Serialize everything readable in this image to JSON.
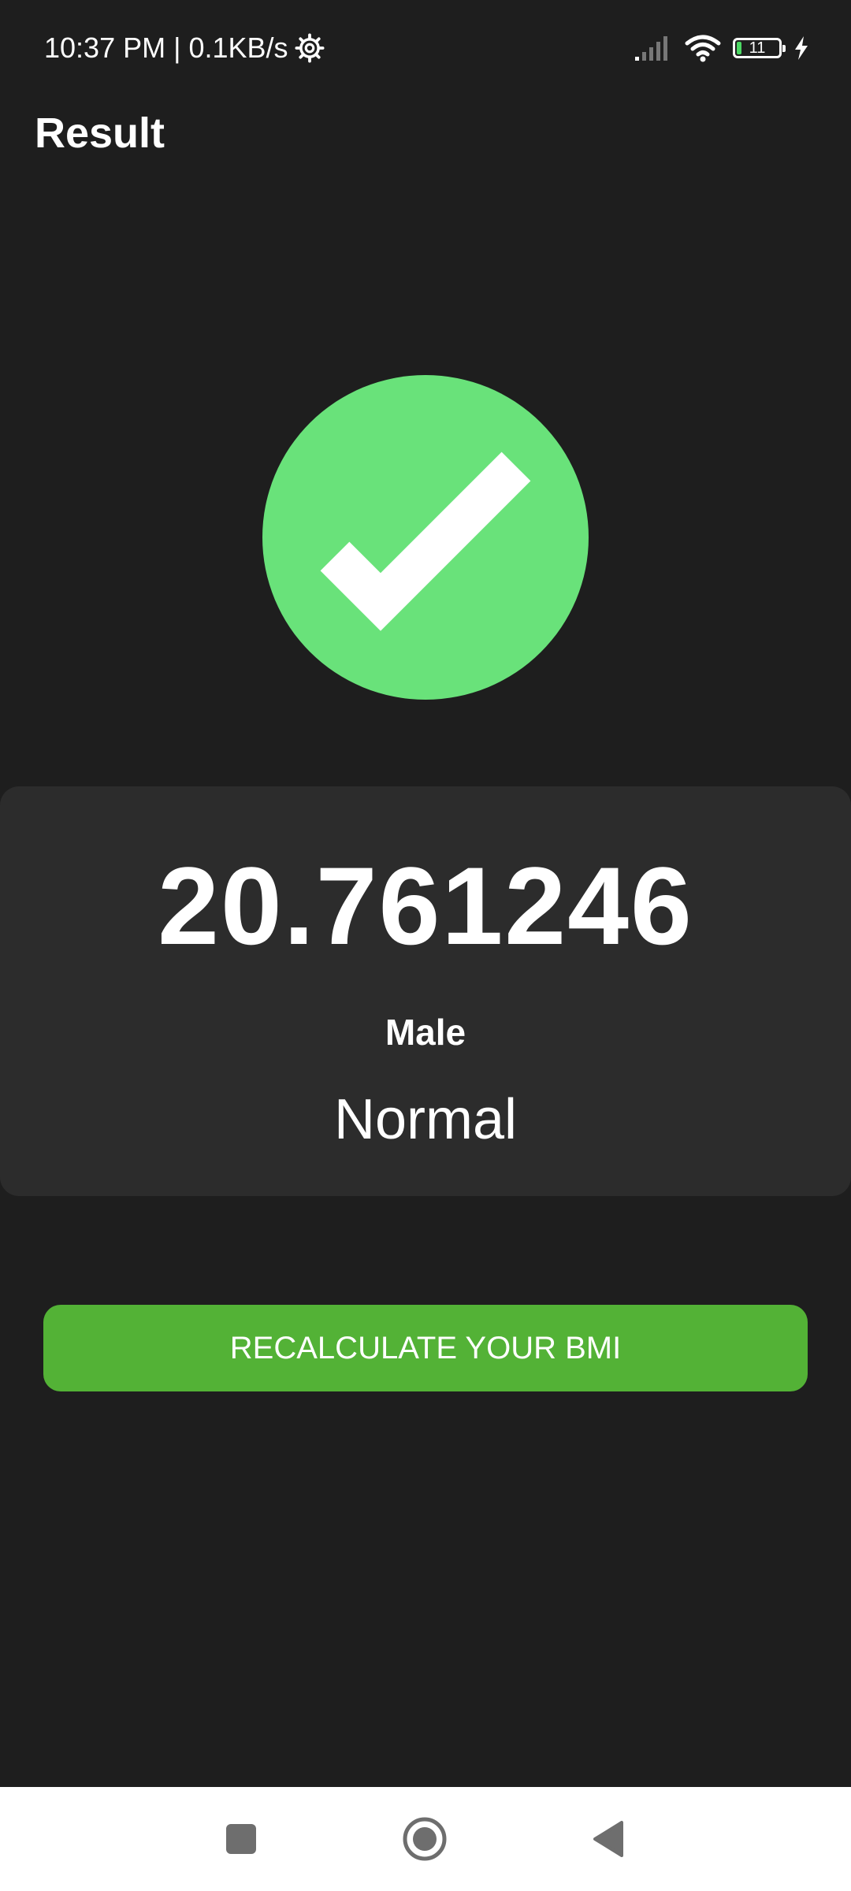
{
  "status_bar": {
    "time_speed": "10:37 PM | 0.1KB/s",
    "battery_level": "11",
    "icons": [
      "settings-gear-icon",
      "signal-icon",
      "wifi-icon",
      "battery-icon",
      "charging-icon"
    ]
  },
  "app_bar": {
    "title": "Result"
  },
  "result": {
    "status_icon": "check-icon",
    "bmi_value": "20.761246",
    "gender": "Male",
    "category": "Normal"
  },
  "actions": {
    "recalculate_label": "RECALCULATE YOUR BMI"
  },
  "nav_bar": {
    "icons": [
      "recents-square-icon",
      "home-circle-icon",
      "back-triangle-icon"
    ]
  },
  "colors": {
    "background": "#1e1e1e",
    "card": "#2c2c2c",
    "check_green": "#69e27a",
    "button_green": "#53b236",
    "text": "#ffffff"
  }
}
